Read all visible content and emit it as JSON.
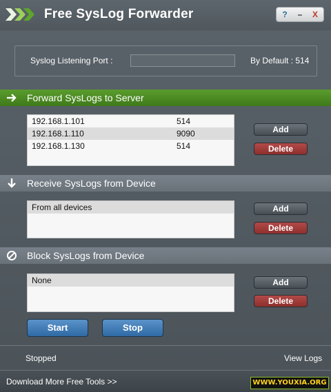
{
  "window": {
    "title": "Free SysLog Forwarder",
    "controls": {
      "help": "?",
      "minimize": "–",
      "close": "X"
    }
  },
  "port": {
    "label": "Syslog Listening Port :",
    "value": "",
    "default_text": "By Default : 514"
  },
  "forward": {
    "title": "Forward SysLogs to Server",
    "rows": [
      {
        "ip": "192.168.1.101",
        "port": "514"
      },
      {
        "ip": "192.168.1.110",
        "port": "9090"
      },
      {
        "ip": "192.168.1.130",
        "port": "514"
      }
    ],
    "add_label": "Add",
    "delete_label": "Delete"
  },
  "receive": {
    "title": "Receive SysLogs from Device",
    "rows": [
      {
        "text": "From all devices"
      }
    ],
    "add_label": "Add",
    "delete_label": "Delete"
  },
  "block": {
    "title": "Block SysLogs from Device",
    "rows": [
      {
        "text": "None"
      }
    ],
    "add_label": "Add",
    "delete_label": "Delete"
  },
  "actions": {
    "start_label": "Start",
    "stop_label": "Stop"
  },
  "status": {
    "text": "Stopped",
    "view_logs": "View Logs"
  },
  "footer": {
    "download": "Download More Free Tools >>",
    "watermark": "WWW.YOUXIA.ORG"
  },
  "colors": {
    "forward_header": "#4e8c24",
    "header_gray": "#727a80",
    "delete_button": "#a03c3a",
    "start_button": "#4a82bb"
  }
}
